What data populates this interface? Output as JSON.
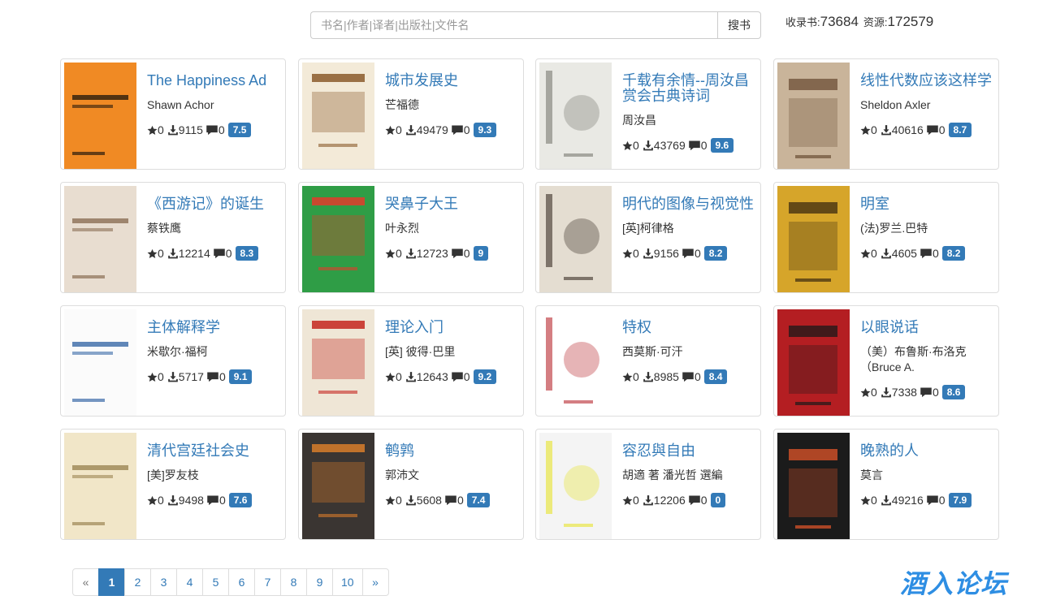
{
  "search": {
    "placeholder": "书名|作者|译者|出版社|文件名",
    "button_label": "搜书"
  },
  "stats": {
    "collected_label": "收录书:",
    "collected_value": "73684",
    "resources_label": "资源:",
    "resources_value": "172579"
  },
  "books": [
    {
      "title": "The Happiness Ad",
      "author": "Shawn Achor",
      "stars": "0",
      "downloads": "9115",
      "comments": "0",
      "score": "7.5",
      "cover_bg": "#f08a24",
      "cover_fg": "#2b1d0e"
    },
    {
      "title": "城市发展史",
      "author": "芒福德",
      "stars": "0",
      "downloads": "49479",
      "comments": "0",
      "score": "9.3",
      "cover_bg": "#f3ead8",
      "cover_fg": "#8a5a2b"
    },
    {
      "title": "千载有余情--周汝昌赏会古典诗词",
      "author": "周汝昌",
      "stars": "0",
      "downloads": "43769",
      "comments": "0",
      "score": "9.6",
      "cover_bg": "#e9e9e4",
      "cover_fg": "#7a7a72"
    },
    {
      "title": "线性代数应该这样学",
      "author": "Sheldon Axler",
      "stars": "0",
      "downloads": "40616",
      "comments": "0",
      "score": "8.7",
      "cover_bg": "#c9b49a",
      "cover_fg": "#6b4e34"
    },
    {
      "title": "《西游记》的诞生",
      "author": "蔡铁鹰",
      "stars": "0",
      "downloads": "12214",
      "comments": "0",
      "score": "8.3",
      "cover_bg": "#e8ddd0",
      "cover_fg": "#8b6f55"
    },
    {
      "title": "哭鼻子大王",
      "author": "叶永烈",
      "stars": "0",
      "downloads": "12723",
      "comments": "0",
      "score": "9",
      "cover_bg": "#2f9d46",
      "cover_fg": "#e33b2b"
    },
    {
      "title": "明代的图像与视觉性",
      "author": "[英]柯律格",
      "stars": "0",
      "downloads": "9156",
      "comments": "0",
      "score": "8.2",
      "cover_bg": "#e4ddd1",
      "cover_fg": "#3a2e25"
    },
    {
      "title": "明室",
      "author": "(法)罗兰.巴特",
      "stars": "0",
      "downloads": "4605",
      "comments": "0",
      "score": "8.2",
      "cover_bg": "#d6a52a",
      "cover_fg": "#3c2b10"
    },
    {
      "title": "主体解释学",
      "author": "米歇尔·福柯",
      "stars": "0",
      "downloads": "5717",
      "comments": "0",
      "score": "9.1",
      "cover_bg": "#fbfbfb",
      "cover_fg": "#3a6aa8"
    },
    {
      "title": "理论入门",
      "author": "[英] 彼得·巴里",
      "stars": "0",
      "downloads": "12643",
      "comments": "0",
      "score": "9.2",
      "cover_bg": "#efe6d6",
      "cover_fg": "#c4261f"
    },
    {
      "title": "特权",
      "author": "西莫斯·可汗",
      "stars": "0",
      "downloads": "8985",
      "comments": "0",
      "score": "8.4",
      "cover_bg": "#ffffff",
      "cover_fg": "#b8282e"
    },
    {
      "title": "以眼说话",
      "author": "（美）布鲁斯·布洛克（Bruce A.",
      "stars": "0",
      "downloads": "7338",
      "comments": "0",
      "score": "8.6",
      "cover_bg": "#b41e22",
      "cover_fg": "#1a1a1a"
    },
    {
      "title": "清代宫廷社会史",
      "author": "[美]罗友枝",
      "stars": "0",
      "downloads": "9498",
      "comments": "0",
      "score": "7.6",
      "cover_bg": "#f1e6c8",
      "cover_fg": "#9c8654"
    },
    {
      "title": "鹌鹑",
      "author": "郭沛文",
      "stars": "0",
      "downloads": "5608",
      "comments": "0",
      "score": "7.4",
      "cover_bg": "#3a3532",
      "cover_fg": "#d87c2a"
    },
    {
      "title": "容忍與自由",
      "author": "胡適 著 潘光哲 選編",
      "stars": "0",
      "downloads": "12206",
      "comments": "0",
      "score": "0",
      "cover_bg": "#f4f4f4",
      "cover_fg": "#e6e22a"
    },
    {
      "title": "晚熟的人",
      "author": "莫言",
      "stars": "0",
      "downloads": "49216",
      "comments": "0",
      "score": "7.9",
      "cover_bg": "#1b1b1b",
      "cover_fg": "#e2552a"
    }
  ],
  "pagination": {
    "prev": "«",
    "pages": [
      "1",
      "2",
      "3",
      "4",
      "5",
      "6",
      "7",
      "8",
      "9",
      "10"
    ],
    "next": "»",
    "current": "1"
  },
  "watermark": "酒入论坛",
  "colors": {
    "link": "#337ab7",
    "badge": "#337ab7",
    "border": "#dddddd"
  },
  "icons": {
    "star": "star-icon",
    "download": "download-icon",
    "comment": "comment-icon"
  }
}
